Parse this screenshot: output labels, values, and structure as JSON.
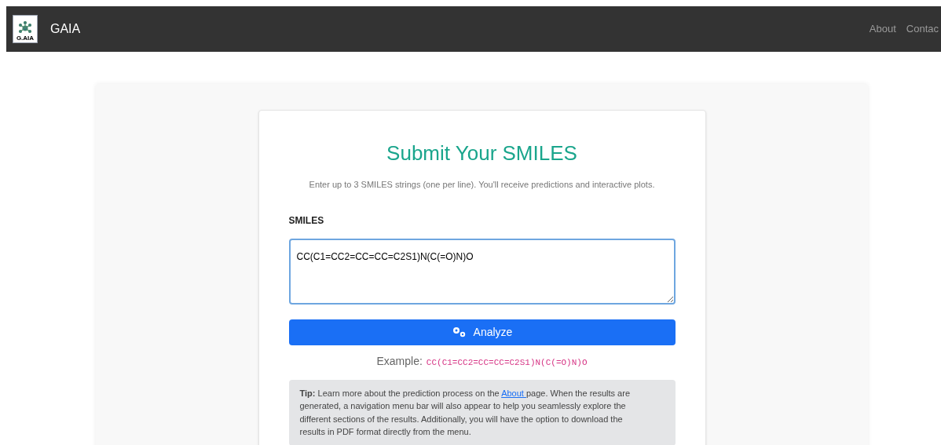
{
  "navbar": {
    "logo_text": "G.AIA",
    "brand": "GAIA",
    "links": [
      "About",
      "Contac"
    ]
  },
  "form": {
    "title": "Submit Your SMILES",
    "subtitle": "Enter up to 3 SMILES strings (one per line). You'll receive predictions and interactive plots.",
    "field_label": "SMILES",
    "value": "CC(C1=CC2=CC=CC=C2S1)N(C(=O)N)O",
    "button": "Analyze",
    "example_label": "Example:",
    "example_code": "CC(C1=CC2=CC=CC=C2S1)N(C(=O)N)O",
    "tip": {
      "before": "**Tip:** Learn more about the prediction process on the",
      "link": "About ",
      "after": "page. When the results are generated, a navigation menu bar will also appear to help you seamlessly explore the different sections of the results. Additionally, you will have the option to download the results in PDF format directly from the menu."
    }
  }
}
